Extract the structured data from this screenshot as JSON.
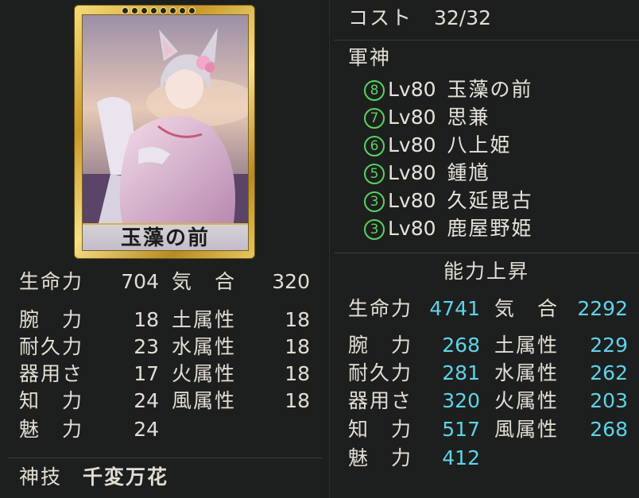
{
  "card": {
    "name": "玉藻の前",
    "rank_dots": 8
  },
  "base_stats": {
    "rows": [
      {
        "l1": "生命力",
        "v1": "704",
        "l2": "気　合",
        "v2": "320"
      },
      {
        "l1": "腕　力",
        "v1": "18",
        "l2": "土属性",
        "v2": "18"
      },
      {
        "l1": "耐久力",
        "v1": "23",
        "l2": "水属性",
        "v2": "18"
      },
      {
        "l1": "器用さ",
        "v1": "17",
        "l2": "火属性",
        "v2": "18"
      },
      {
        "l1": "知　力",
        "v1": "24",
        "l2": "風属性",
        "v2": "18"
      },
      {
        "l1": "魅　力",
        "v1": "24",
        "l2": "",
        "v2": ""
      }
    ]
  },
  "skill": {
    "label": "神技",
    "name": "千変万花"
  },
  "cost": {
    "label": "コスト",
    "value": "32/32"
  },
  "gunshin": {
    "title": "軍神",
    "items": [
      {
        "num": "8",
        "level": "Lv80",
        "name": "玉藻の前"
      },
      {
        "num": "7",
        "level": "Lv80",
        "name": "思兼"
      },
      {
        "num": "6",
        "level": "Lv80",
        "name": "八上姫"
      },
      {
        "num": "5",
        "level": "Lv80",
        "name": "鍾馗"
      },
      {
        "num": "3",
        "level": "Lv80",
        "name": "久延毘古"
      },
      {
        "num": "3",
        "level": "Lv80",
        "name": "鹿屋野姫"
      }
    ]
  },
  "boost": {
    "title": "能力上昇",
    "rows": [
      {
        "l1": "生命力",
        "v1": "4741",
        "l2": "気　合",
        "v2": "2292"
      },
      {
        "l1": "腕　力",
        "v1": "268",
        "l2": "土属性",
        "v2": "229"
      },
      {
        "l1": "耐久力",
        "v1": "281",
        "l2": "水属性",
        "v2": "262"
      },
      {
        "l1": "器用さ",
        "v1": "320",
        "l2": "火属性",
        "v2": "203"
      },
      {
        "l1": "知　力",
        "v1": "517",
        "l2": "風属性",
        "v2": "268"
      },
      {
        "l1": "魅　力",
        "v1": "412",
        "l2": "",
        "v2": ""
      }
    ]
  },
  "colors": {
    "background": "#1d1f1e",
    "value_cyan": "#5fd3e8",
    "circle_green": "#59d25f",
    "card_gold": "#d6b34a"
  }
}
